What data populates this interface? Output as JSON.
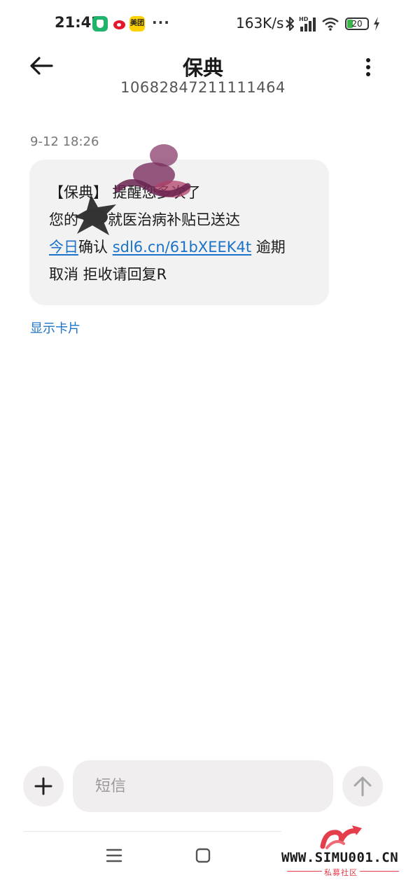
{
  "status_bar": {
    "time": "21:42",
    "meituan_label": "美团",
    "more": "···",
    "speed": "163K/s",
    "battery": "20"
  },
  "header": {
    "title": "保典",
    "number": "10682847211111464"
  },
  "message": {
    "time": "9-12 18:26",
    "line1": "【保典】 提醒您多次了",
    "line2_prefix": "您的",
    "line2_suffix": "就医治病补贴已送达",
    "link_today": "今日",
    "confirm": "确认 ",
    "link_url": "sdl6.cn/61bXEEK4t",
    "after_link": " 逾期",
    "line4": "取消 拒收请回复R"
  },
  "show_card": "显示卡片",
  "compose": {
    "placeholder": "短信"
  },
  "watermark": {
    "site": "WWW.SIMU001.CN",
    "sub": "私募社区"
  },
  "colors": {
    "link": "#1a73c8",
    "bubble": "#f2f2f2",
    "watermark_red": "#e43d4b"
  }
}
